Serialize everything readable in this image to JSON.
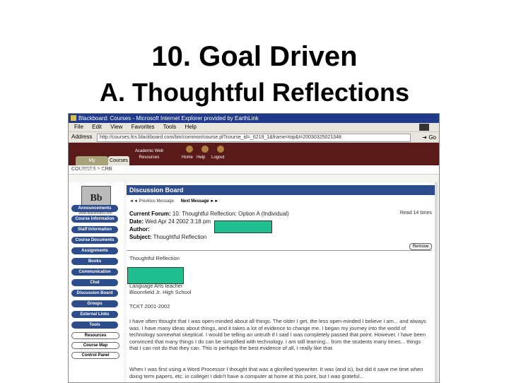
{
  "slide": {
    "title": "10. Goal Driven",
    "subtitle": "A. Thoughtful Reflections"
  },
  "browser": {
    "title": "Blackboard: Courses - Microsoft Internet Explorer provided by EarthLink",
    "menu": [
      "File",
      "Edit",
      "View",
      "Favorites",
      "Tools",
      "Help"
    ],
    "address_label": "Address",
    "address_value": "http://courses.fcs.blackboard.com/bin/common/course.pl?course_id=_6219_1&frame=top&t=20030325021348",
    "go_label": "Go"
  },
  "bb": {
    "tabs": {
      "my": "My Blackboard",
      "courses": "Courses",
      "academic": "Academic Web Resources"
    },
    "header_icons": {
      "home": "Home",
      "help": "Help",
      "logout": "Logout"
    },
    "breadcrumb": "COURSES > CRB",
    "logo_text": "Bb",
    "logo_caption": "www.blackboard.com",
    "nav": [
      "Announcements",
      "Course Information",
      "Staff Information",
      "Course Documents",
      "Assignments",
      "Books",
      "Communication",
      "Chat",
      "Discussion Board",
      "Groups",
      "External Links",
      "Tools",
      "Resources",
      "Course Map",
      "Control Panel"
    ],
    "board_title": "Discussion Board",
    "prev": "◄◄ Previous Message",
    "next": "Next Message ►►",
    "forum_label": "Current Forum:",
    "forum_value": "10. Thoughtful Reflection: Option A (Individual)",
    "read": "Read 14 times",
    "date_label": "Date:",
    "date_value": "Wed Apr 24 2002 3:18 pm",
    "author_label": "Author:",
    "subject_label": "Subject:",
    "subject_value": "Thoughtful Reflection",
    "remove": "Remove",
    "post_heading": "Thoughtful Reflection",
    "role": "Language Arts teacher",
    "school": "Bloomfield Jr. High School",
    "term": "TCKT 2001-2002",
    "paragraph1": "I have often thought that I was open-minded about all things. The older I get, the less open-minded I believe I am... and always was. I have many ideas about things, and it takes a lot of evidence to change me. I began my journey into the world of technology somewhat skeptical. I would be telling an untruth if I said I was completely passed that point. However, I have been convinced that many things I do can be simplified with technology. I am still learning... from the students many times... things that I can not do that they can. This is perhaps the best evidence of all, I really like that.",
    "paragraph2": "When I was first using a Word Processor I thought that was a glorified typewriter. It was (and is), but did it save me time when doing term papers, etc. in college! I didn't have a computer at home at this point, but I was grateful..."
  },
  "colors": {
    "redaction": "#1fbf8f",
    "bb_nav": "#2c4c8c",
    "bb_header": "#5a1a1a"
  }
}
